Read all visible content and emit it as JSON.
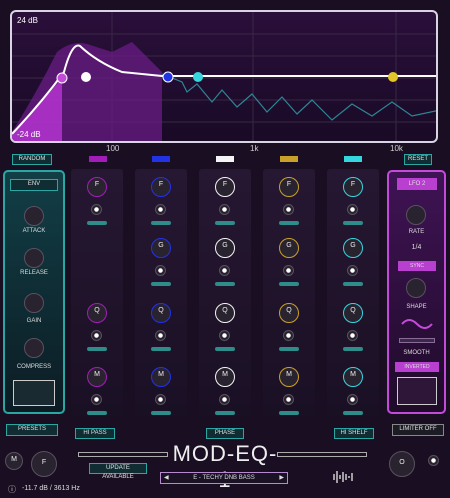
{
  "eq": {
    "top_db": "24 dB",
    "bottom_db": "-24 dB",
    "freqs": [
      "100",
      "1k",
      "10k"
    ]
  },
  "buttons": {
    "random": "RANDOM",
    "reset": "RESET",
    "presets": "PRESETS",
    "limiter": "LIMITER OFF",
    "update": "UPDATE AVAILABLE"
  },
  "env": {
    "mode": "ENV",
    "knobs": [
      "ATTACK",
      "RELEASE",
      "GAIN",
      "COMPRESS"
    ]
  },
  "lfo": {
    "mode": "LFO 2",
    "rate": "RATE",
    "rate_value": "1/4",
    "sync": "SYNC",
    "shape": "SHAPE",
    "smooth": "SMOOTH",
    "inverted": "INVERTED"
  },
  "bands": [
    {
      "color": "#a21db8",
      "labels": [
        "F",
        "",
        "Q",
        "M"
      ],
      "tag": "HI PASS"
    },
    {
      "color": "#2233e6",
      "labels": [
        "F",
        "G",
        "Q",
        "M"
      ],
      "tag": ""
    },
    {
      "color": "#f4f4f4",
      "labels": [
        "F",
        "G",
        "Q",
        "M"
      ],
      "tag": "PHASE"
    },
    {
      "color": "#c9a12a",
      "labels": [
        "F",
        "G",
        "Q",
        "M"
      ],
      "tag": ""
    },
    {
      "color": "#36d6df",
      "labels": [
        "F",
        "G",
        "Q",
        "M"
      ],
      "tag": "HI SHELF"
    }
  ],
  "footer": {
    "title": "MOD-EQ-1",
    "preset": "E - TECHY DNB BASS",
    "readout": "-11.7 dB / 3613 Hz",
    "m": "M",
    "f": "F",
    "o": "O"
  }
}
